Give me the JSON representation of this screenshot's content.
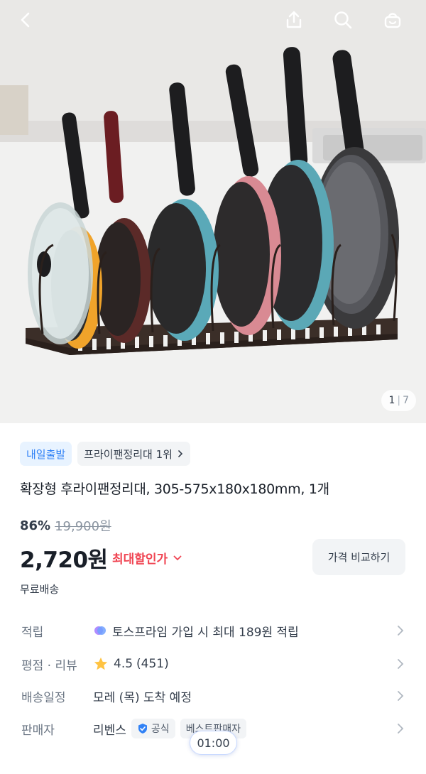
{
  "gallery": {
    "current": "1",
    "total": "7",
    "separator": "|"
  },
  "badges": {
    "delivery": "내일출발",
    "ranking": "프라이팬정리대 1위"
  },
  "product": {
    "title": "확장형 후라이팬정리대, 305-575x180x180mm, 1개",
    "discount": "86%",
    "original_price": "19,900원",
    "price": "2,720원",
    "max_discount_label": "최대할인가",
    "compare_label": "가격 비교하기",
    "shipping": "무료배송"
  },
  "details": {
    "points": {
      "label": "적립",
      "value": "토스프라임 가입 시 최대 189원 적립"
    },
    "rating": {
      "label": "평점 · 리뷰",
      "score": "4.5",
      "count": "(451)"
    },
    "delivery": {
      "label": "배송일정",
      "value": "모레 (목) 도착 예정"
    },
    "seller": {
      "label": "판매자",
      "name": "리벤스",
      "official": "공식",
      "best": "베스트판매자"
    }
  },
  "timer": "01:00",
  "colors": {
    "accent": "#3182f6",
    "sale": "#f04452",
    "star": "#ffc342",
    "chip_bg": "#e8f3ff"
  },
  "icons": [
    "back-icon",
    "share-icon",
    "search-icon",
    "cart-icon",
    "chevron-right-icon",
    "chevron-down-icon",
    "star-icon",
    "verified-icon",
    "prime-icon"
  ]
}
